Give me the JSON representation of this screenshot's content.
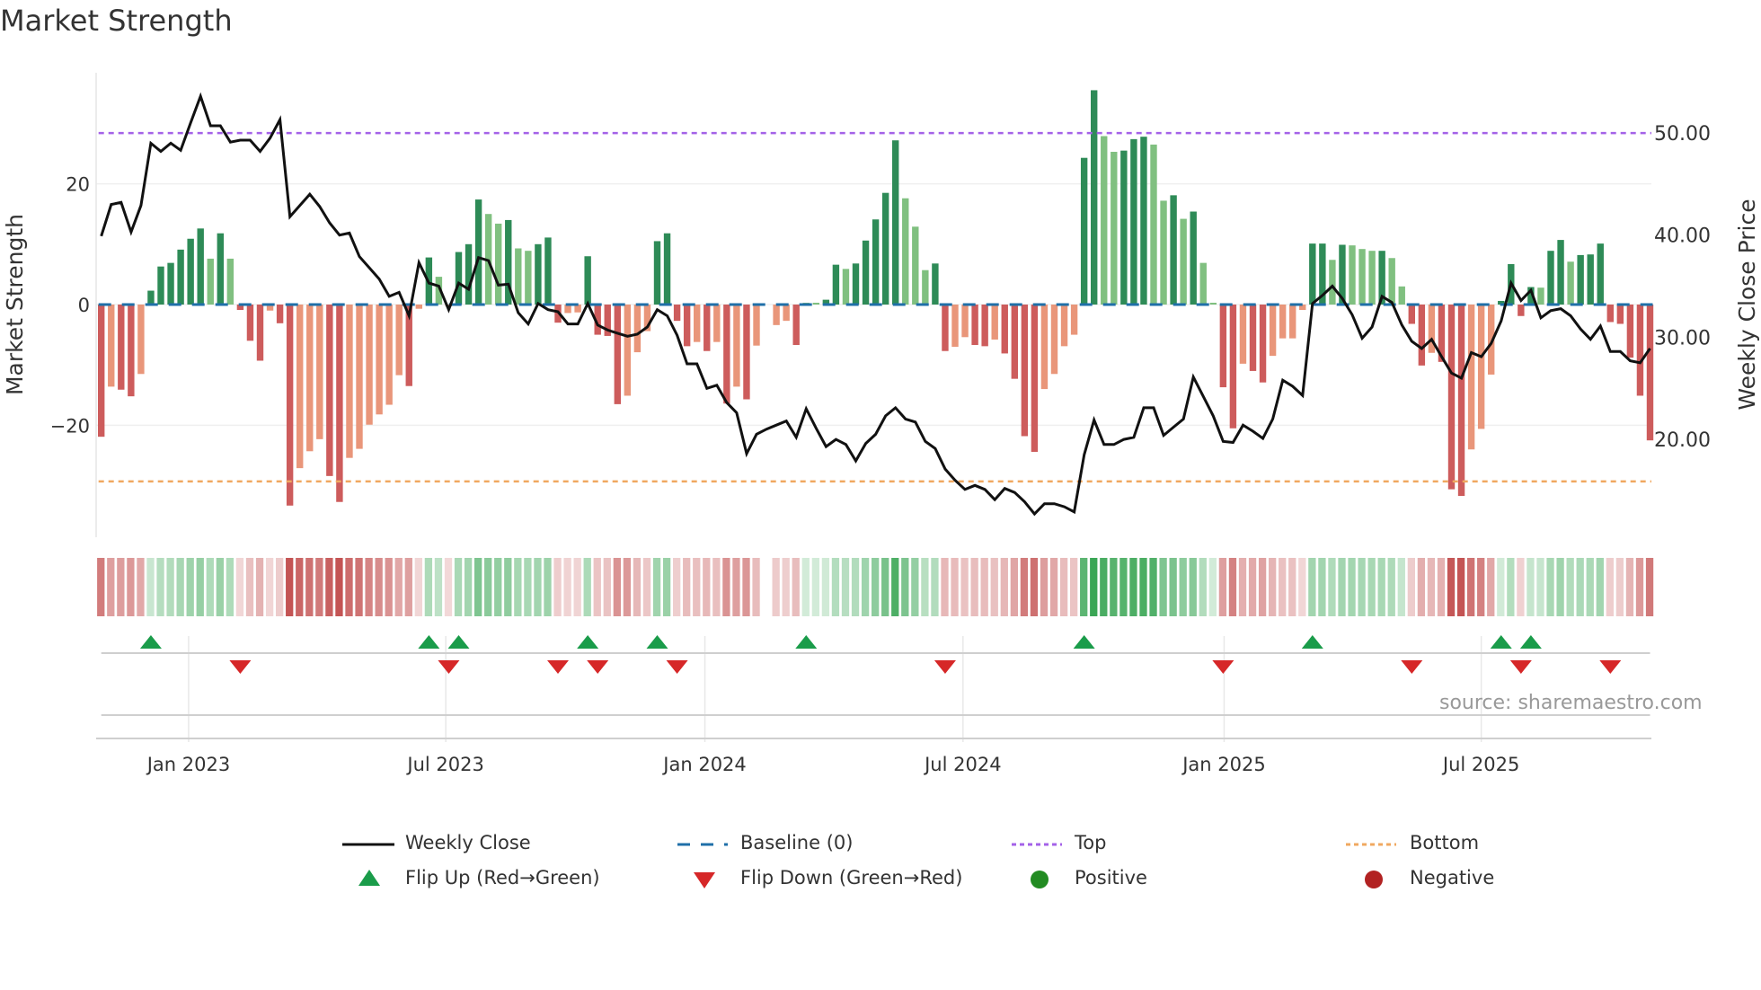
{
  "title": "Market Strength",
  "source": "source: sharemaestro.com",
  "legend": {
    "weekly_close": "Weekly Close",
    "baseline": "Baseline (0)",
    "top": "Top",
    "bottom": "Bottom",
    "flip_up": "Flip Up (Red→Green)",
    "flip_down": "Flip Down (Green→Red)",
    "positive": "Positive",
    "negative": "Negative"
  },
  "colors": {
    "pos_strong": "#2e8b57",
    "pos_weak": "#80c080",
    "neg_strong": "#cd5c5c",
    "neg_weak": "#e9967a",
    "baseline": "#1f6fa8",
    "top": "#a462e8",
    "bottom": "#f0a860",
    "price": "#111111",
    "flip_up": "#1a9c4a",
    "flip_down": "#d62728",
    "positive": "#228b22",
    "negative": "#b22222"
  },
  "chart_data": {
    "type": "bar+line",
    "title": "Market Strength",
    "ylabel": "Market Strength",
    "y2label": "Weekly Close Price",
    "ylim": [
      -38.5,
      38.5
    ],
    "y2lim": [
      11.7,
      55.8
    ],
    "yticks": [
      {
        "v": 20,
        "label": "20"
      },
      {
        "v": 0,
        "label": "0"
      },
      {
        "v": -20,
        "label": "−20"
      }
    ],
    "y2ticks": [
      {
        "v": 50,
        "label": "50.00"
      },
      {
        "v": 40,
        "label": "40.00"
      },
      {
        "v": 30,
        "label": "30.00"
      },
      {
        "v": 20,
        "label": "20.00"
      }
    ],
    "xticks": [
      {
        "week": 8.8,
        "label": "Jan 2023"
      },
      {
        "week": 34.7,
        "label": "Jul 2023"
      },
      {
        "week": 60.8,
        "label": "Jan 2024"
      },
      {
        "week": 86.8,
        "label": "Jul 2024"
      },
      {
        "week": 113.1,
        "label": "Jan 2025"
      },
      {
        "week": 139.0,
        "label": "Jul 2025"
      }
    ],
    "top_level": 28.4,
    "bottom_level": -29.3,
    "strength": [
      -21.9,
      -13.6,
      -14.1,
      -15.2,
      -11.5,
      2.3,
      6.3,
      6.9,
      9.1,
      10.9,
      12.6,
      7.6,
      11.8,
      7.6,
      -0.9,
      -6,
      -9.3,
      -1,
      -3.1,
      -33.3,
      -27.1,
      -24.3,
      -22.3,
      -28.4,
      -32.7,
      -25.4,
      -23.9,
      -19.9,
      -18.2,
      -16.6,
      -11.7,
      -13.5,
      -0.7,
      7.8,
      4.6,
      -0.3,
      8.7,
      10,
      17.4,
      15,
      13.4,
      14,
      9.3,
      8.9,
      10,
      11.1,
      -3,
      -1.4,
      -1.3,
      8,
      -5,
      -5.2,
      -16.5,
      -15.1,
      -7.9,
      -4.4,
      10.5,
      11.8,
      -2.7,
      -6.9,
      -6.2,
      -7.7,
      -6.2,
      -16.4,
      -13.6,
      -15.7,
      -6.8,
      null,
      -3.4,
      -2.7,
      -6.7,
      0.3,
      0.3,
      0.8,
      6.6,
      5.9,
      6.8,
      10.6,
      14.1,
      18.5,
      27.2,
      17.6,
      12.9,
      5.7,
      6.8,
      -7.7,
      -7,
      -5.4,
      -6.7,
      -6.9,
      -5.8,
      -8.1,
      -12.3,
      -21.8,
      -24.4,
      -14,
      -11.5,
      -6.9,
      -5,
      24.3,
      35.5,
      27.9,
      25.3,
      25.5,
      27.4,
      27.8,
      26.5,
      17.2,
      18.1,
      14.2,
      15.4,
      6.9,
      0.3,
      -13.7,
      -20.5,
      -9.8,
      -11,
      -12.9,
      -8.5,
      -5.6,
      -5.6,
      -0.9,
      10.1,
      10.1,
      7.4,
      9.9,
      9.8,
      9.2,
      8.9,
      8.9,
      7.7,
      3,
      -3.2,
      -10.1,
      -8,
      -9.5,
      -30.6,
      -31.7,
      -24,
      -20.6,
      -11.6,
      0.6,
      6.7,
      -1.9,
      2.9,
      2.8,
      8.9,
      10.7,
      7.1,
      8.2,
      8.3,
      10.1,
      -2.9,
      -3.2,
      -8.8,
      -15.1,
      -22.5
    ],
    "strength_shade": "DLDDLDDDDDDLDLDDDLDDLLLDDLLLLLLDLDLLDDDLLDLLDDDLLDDDDLLLDDDDLDLDLDLLLLDLLDDLDDDDDLLLDDLLDDLDDDDLLLLDDLLDDDLLDLDLLDDLDDLLLLDDLDLLLDLLDDLDDDLLLDDDDLDDLDDDDDDDD",
    "weekly_close": [
      39.9,
      43.0,
      43.2,
      40.3,
      42.9,
      49.0,
      48.2,
      49.0,
      48.3,
      51.0,
      53.6,
      50.7,
      50.7,
      49.1,
      49.3,
      49.3,
      48.2,
      49.5,
      51.3,
      41.8,
      42.9,
      44.0,
      42.8,
      41.2,
      40.0,
      40.2,
      37.9,
      36.8,
      35.7,
      34.0,
      34.4,
      32.1,
      37.3,
      35.3,
      35.0,
      32.7,
      35.3,
      34.7,
      37.8,
      37.5,
      35.1,
      35.2,
      32.4,
      31.3,
      33.3,
      32.7,
      32.5,
      31.3,
      31.3,
      33.3,
      31.2,
      30.7,
      30.4,
      30.1,
      30.3,
      31.0,
      32.7,
      32.1,
      30.2,
      27.4,
      27.4,
      25.0,
      25.3,
      23.6,
      22.6,
      18.6,
      20.5,
      21.0,
      21.4,
      21.8,
      20.2,
      23.0,
      21.1,
      19.3,
      20.0,
      19.5,
      17.9,
      19.6,
      20.5,
      22.3,
      23.1,
      22.0,
      21.7,
      19.8,
      19.1,
      17.1,
      16.0,
      15.1,
      15.5,
      15.1,
      14.1,
      15.2,
      14.8,
      13.9,
      12.7,
      13.7,
      13.7,
      13.4,
      12.9,
      18.5,
      21.9,
      19.5,
      19.5,
      20.0,
      20.2,
      23.1,
      23.1,
      20.4,
      21.2,
      22.0,
      26.1,
      24.2,
      22.3,
      19.8,
      19.7,
      21.4,
      20.8,
      20.1,
      22.0,
      25.8,
      25.2,
      24.3,
      33.3,
      34.1,
      35.0,
      33.8,
      32.2,
      29.9,
      31.0,
      34.0,
      33.4,
      31.2,
      29.6,
      28.9,
      29.8,
      28.1,
      26.5,
      26.0,
      28.5,
      28.1,
      29.4,
      31.6,
      35.3,
      33.6,
      34.6,
      31.9,
      32.6,
      32.8,
      32.1,
      30.8,
      29.8,
      31.1,
      28.6,
      28.6,
      27.7,
      27.5,
      28.9
    ],
    "flip_up_weeks": [
      5,
      33,
      36,
      49,
      56,
      71,
      99,
      122,
      141,
      144
    ],
    "flip_down_weeks": [
      14,
      35,
      46,
      50,
      58,
      85,
      113,
      132,
      143,
      152
    ],
    "legend_position": "bottom"
  }
}
